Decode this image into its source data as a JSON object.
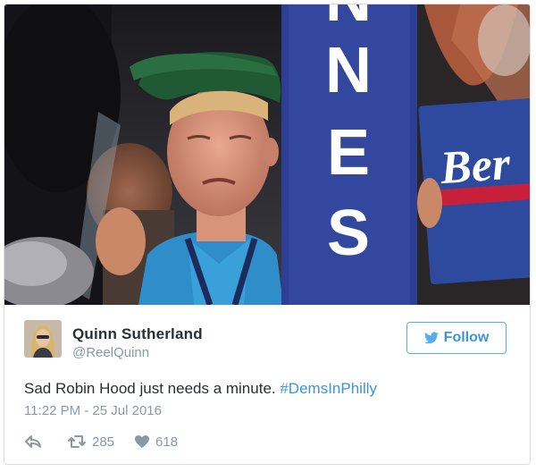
{
  "tweet": {
    "author_name": "Quinn Sutherland",
    "author_handle": "@ReelQuinn",
    "follow_label": "Follow",
    "text_plain": "Sad Robin Hood just needs a minute. ",
    "hashtag": "#DemsInPhilly",
    "timestamp": "11:22 PM - 25 Jul 2016",
    "retweet_count": "285",
    "like_count": "618"
  },
  "media": {
    "sign_letters": "NNES",
    "sign_text": "Ber"
  },
  "icons": {
    "follow": "twitter-bird-icon",
    "reply": "reply-icon",
    "retweet": "retweet-icon",
    "like": "heart-icon"
  },
  "colors": {
    "link": "#3b94d9",
    "follow_border": "#55acee",
    "muted": "#8899a6",
    "text": "#292f33",
    "sign_blue": "#2c3f94",
    "shirt_blue": "#2f8ec9",
    "hat_green": "#1f5a35"
  }
}
